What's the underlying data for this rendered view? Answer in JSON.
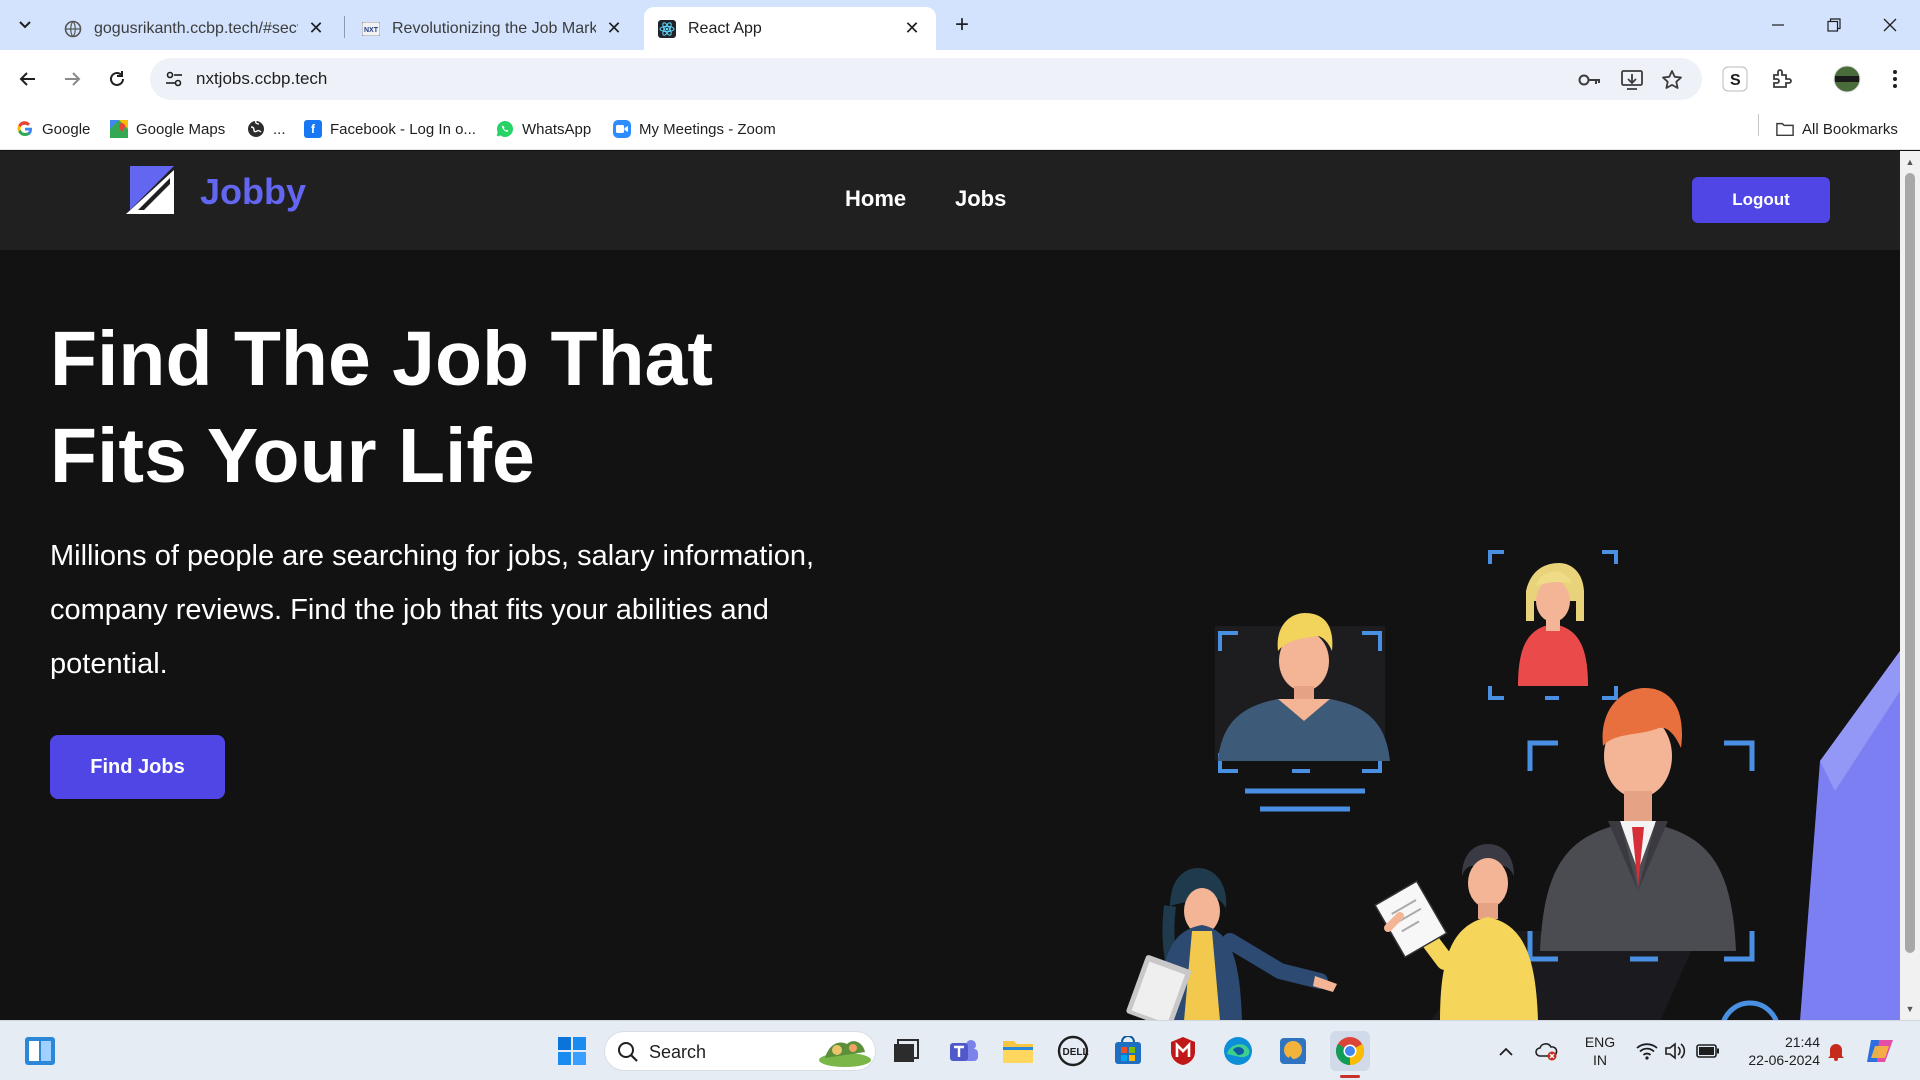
{
  "browser": {
    "tabs": [
      {
        "title": "gogusrikanth.ccbp.tech/#sectio",
        "active": false,
        "icon": "globe-icon"
      },
      {
        "title": "Revolutionizing the Job Market",
        "active": false,
        "icon": "nxtwave-icon"
      },
      {
        "title": "React App",
        "active": true,
        "icon": "react-icon"
      }
    ],
    "url": "nxtjobs.ccbp.tech",
    "profile_letter": "S",
    "bookmarks": [
      {
        "label": "Google",
        "icon": "google-icon"
      },
      {
        "label": "Google Maps",
        "icon": "google-maps-icon"
      },
      {
        "label": "...",
        "icon": "globe-icon"
      },
      {
        "label": "Facebook - Log In o...",
        "icon": "facebook-icon"
      },
      {
        "label": "WhatsApp",
        "icon": "whatsapp-icon"
      },
      {
        "label": "My Meetings - Zoom",
        "icon": "zoom-icon"
      }
    ],
    "all_bookmarks": "All Bookmarks"
  },
  "app": {
    "logo_text": "Jobby",
    "nav": {
      "home": "Home",
      "jobs": "Jobs"
    },
    "logout_label": "Logout",
    "hero_title": "Find The Job That Fits Your Life",
    "hero_description": "Millions of people are searching for jobs, salary information, company reviews. Find the job that fits your abilities and potential.",
    "find_jobs_label": "Find Jobs",
    "colors": {
      "accent": "#4f46e5",
      "logo": "#6366f1",
      "header_bg": "#202020",
      "page_bg": "#121212"
    }
  },
  "taskbar": {
    "search_placeholder": "Search",
    "lang": "ENG",
    "region": "IN",
    "time": "21:44",
    "date": "22-06-2024"
  }
}
